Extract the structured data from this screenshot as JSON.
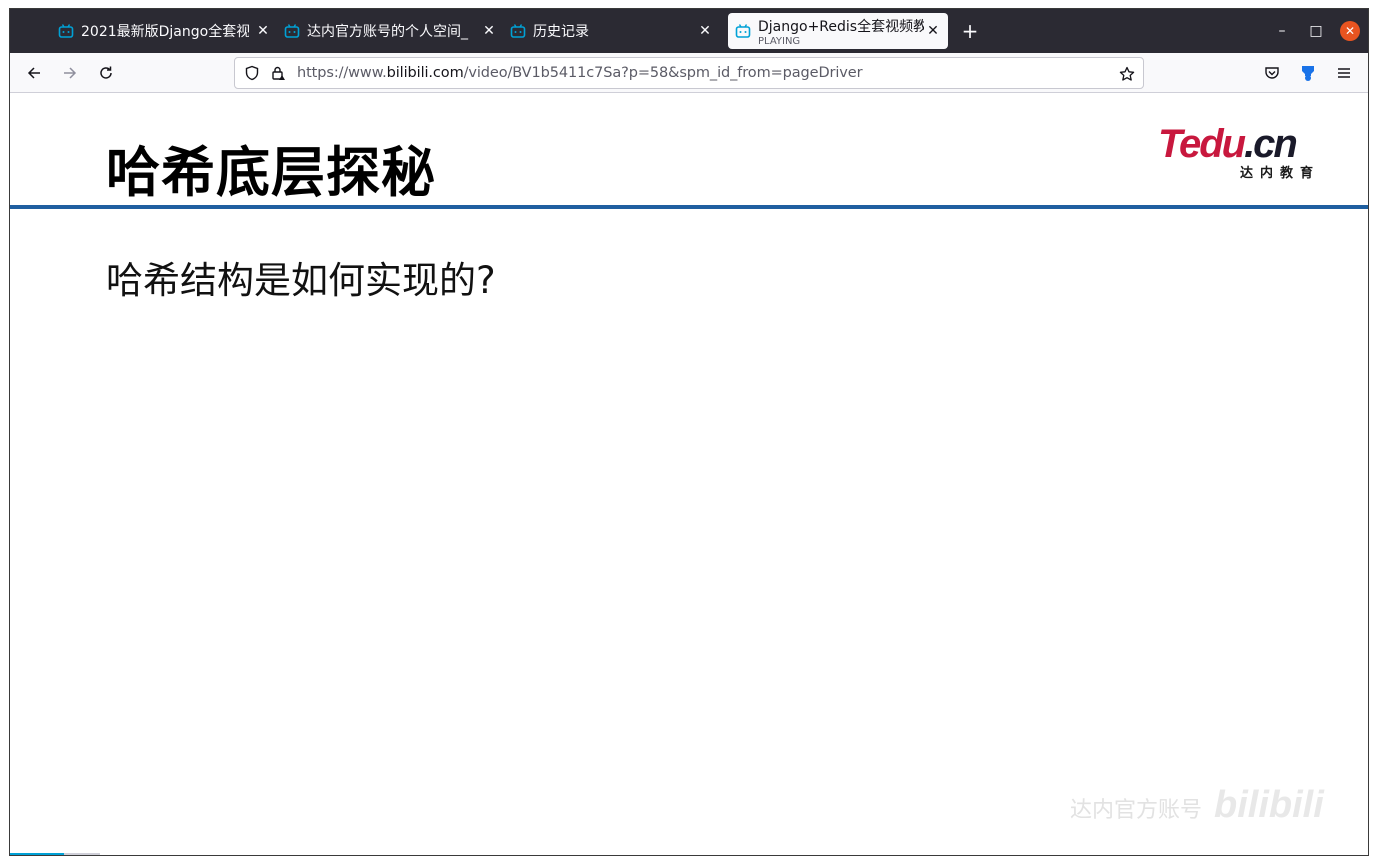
{
  "tabs": [
    {
      "title": "2021最新版Django全套视",
      "active": false
    },
    {
      "title": "达内官方账号的个人空间_",
      "active": false
    },
    {
      "title": "历史记录",
      "active": false
    },
    {
      "title": "Django+Redis全套视频教",
      "subtitle": "PLAYING",
      "active": true
    }
  ],
  "urlbar": {
    "prefix": "https://www.",
    "domain": "bilibili.com",
    "path": "/video/BV1b5411c7Sa?p=58&spm_id_from=pageDriver"
  },
  "slide": {
    "title": "哈希底层探秘",
    "text": "哈希结构是如何实现的?",
    "logo_main": "Tedu",
    "logo_dot": ".cn",
    "logo_sub": "达内教育"
  },
  "watermark": {
    "text": "达内官方账号",
    "brand": "bilibili"
  },
  "colors": {
    "tabbar": "#2b2a33",
    "rule": "#1f5fa0",
    "logo": "#c8183e",
    "close_button": "#e95420",
    "bilibili_blue": "#00a1d6"
  },
  "video_progress": 0.6
}
